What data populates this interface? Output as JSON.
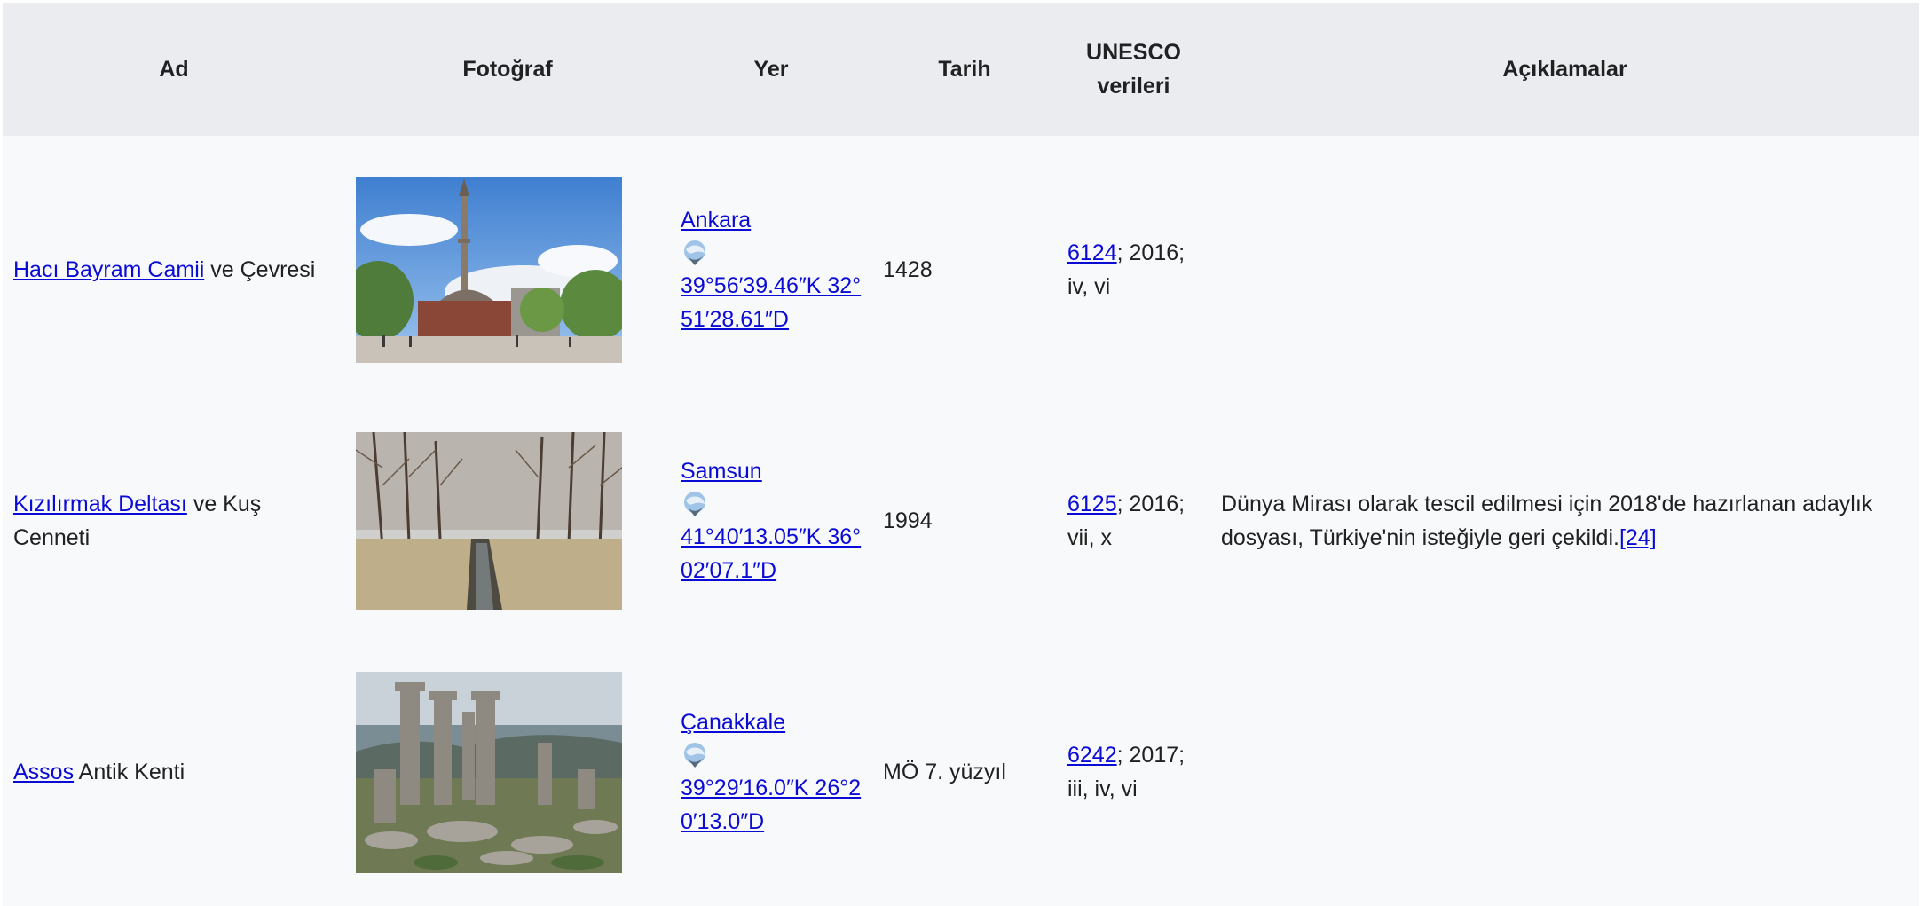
{
  "table": {
    "headers": {
      "ad": "Ad",
      "fotograf": "Fotoğraf",
      "yer": "Yer",
      "tarih": "Tarih",
      "unesco_line1": "UNESCO",
      "unesco_line2": "verileri",
      "aciklamalar": "Açıklamalar"
    },
    "rows": [
      {
        "name_link": "Hacı Bayram Camii",
        "name_rest": " ve Çevresi",
        "photo_icon": "mosque-photo",
        "place": "Ankara",
        "coords": "39°56′39.46″K 32°51′28.61″D",
        "date": "1428",
        "unesco_id": "6124",
        "unesco_rest": "; 2016;",
        "unesco_criteria": "iv, vi",
        "note": "",
        "note_ref": ""
      },
      {
        "name_link": "Kızılırmak Deltası",
        "name_rest": " ve Kuş Cenneti",
        "photo_icon": "delta-forest-photo",
        "place": "Samsun",
        "coords": "41°40′13.05″K 36°02′07.1″D",
        "date": "1994",
        "unesco_id": "6125",
        "unesco_rest": "; 2016;",
        "unesco_criteria": "vii, x",
        "note": "Dünya Mirası olarak tescil edilmesi için 2018'de hazırlanan adaylık dosyası, Türkiye'nin isteğiyle geri çekildi.",
        "note_ref": "[24]"
      },
      {
        "name_link": "Assos",
        "name_rest": " Antik Kenti",
        "photo_icon": "ancient-columns-photo",
        "place": "Çanakkale",
        "coords": "39°29′16.0″K 26°20′13.0″D",
        "date": "MÖ 7. yüzyıl",
        "unesco_id": "6242",
        "unesco_rest": "; 2017;",
        "unesco_criteria": "iii, iv, vi",
        "note": "",
        "note_ref": ""
      }
    ]
  }
}
